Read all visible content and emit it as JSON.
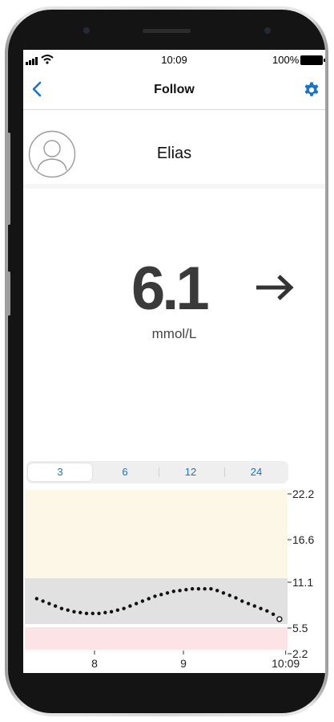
{
  "status_bar": {
    "time": "10:09",
    "battery": "100%"
  },
  "nav": {
    "title": "Follow",
    "back_icon": "chevron-left-icon",
    "settings_icon": "gear-icon"
  },
  "profile": {
    "name": "Elias",
    "avatar_icon": "user-avatar-icon"
  },
  "reading": {
    "value": "6.1",
    "unit": "mmol/L",
    "trend_icon": "arrow-right-icon",
    "trend": "steady"
  },
  "time_range": {
    "options": [
      "3",
      "6",
      "12",
      "24"
    ],
    "selected": "3"
  },
  "colors": {
    "accent": "#1a73c7",
    "high_zone": "#fcf7e6",
    "target_zone": "#e1e1e1",
    "low_zone": "#fbe3e6"
  },
  "chart_data": {
    "type": "scatter",
    "y_ticks": [
      "22.2",
      "16.6",
      "11.1",
      "5.5",
      "2.2"
    ],
    "x_ticks": [
      "8",
      "9",
      "10:09"
    ],
    "ylim": [
      2.2,
      22.2
    ],
    "target_range": [
      5.5,
      11.1
    ],
    "low_threshold": 3.9,
    "x": [
      7.35,
      7.42,
      7.49,
      7.56,
      7.63,
      7.7,
      7.77,
      7.84,
      7.91,
      7.98,
      8.05,
      8.12,
      8.19,
      8.26,
      8.33,
      8.4,
      8.47,
      8.54,
      8.61,
      8.68,
      8.75,
      8.82,
      8.89,
      8.96,
      9.03,
      9.1,
      9.17,
      9.24,
      9.31,
      9.38,
      9.45,
      9.52,
      9.59,
      9.66,
      9.73,
      9.8,
      9.87,
      9.94,
      10.01,
      10.08
    ],
    "y": [
      8.6,
      8.3,
      8.0,
      7.7,
      7.4,
      7.2,
      7.0,
      6.9,
      6.8,
      6.8,
      6.8,
      6.9,
      7.0,
      7.2,
      7.4,
      7.7,
      8.0,
      8.3,
      8.6,
      8.9,
      9.1,
      9.3,
      9.5,
      9.6,
      9.7,
      9.8,
      9.8,
      9.8,
      9.8,
      9.6,
      9.3,
      9.0,
      8.7,
      8.3,
      8.0,
      7.7,
      7.4,
      7.1,
      6.7,
      6.1
    ]
  }
}
